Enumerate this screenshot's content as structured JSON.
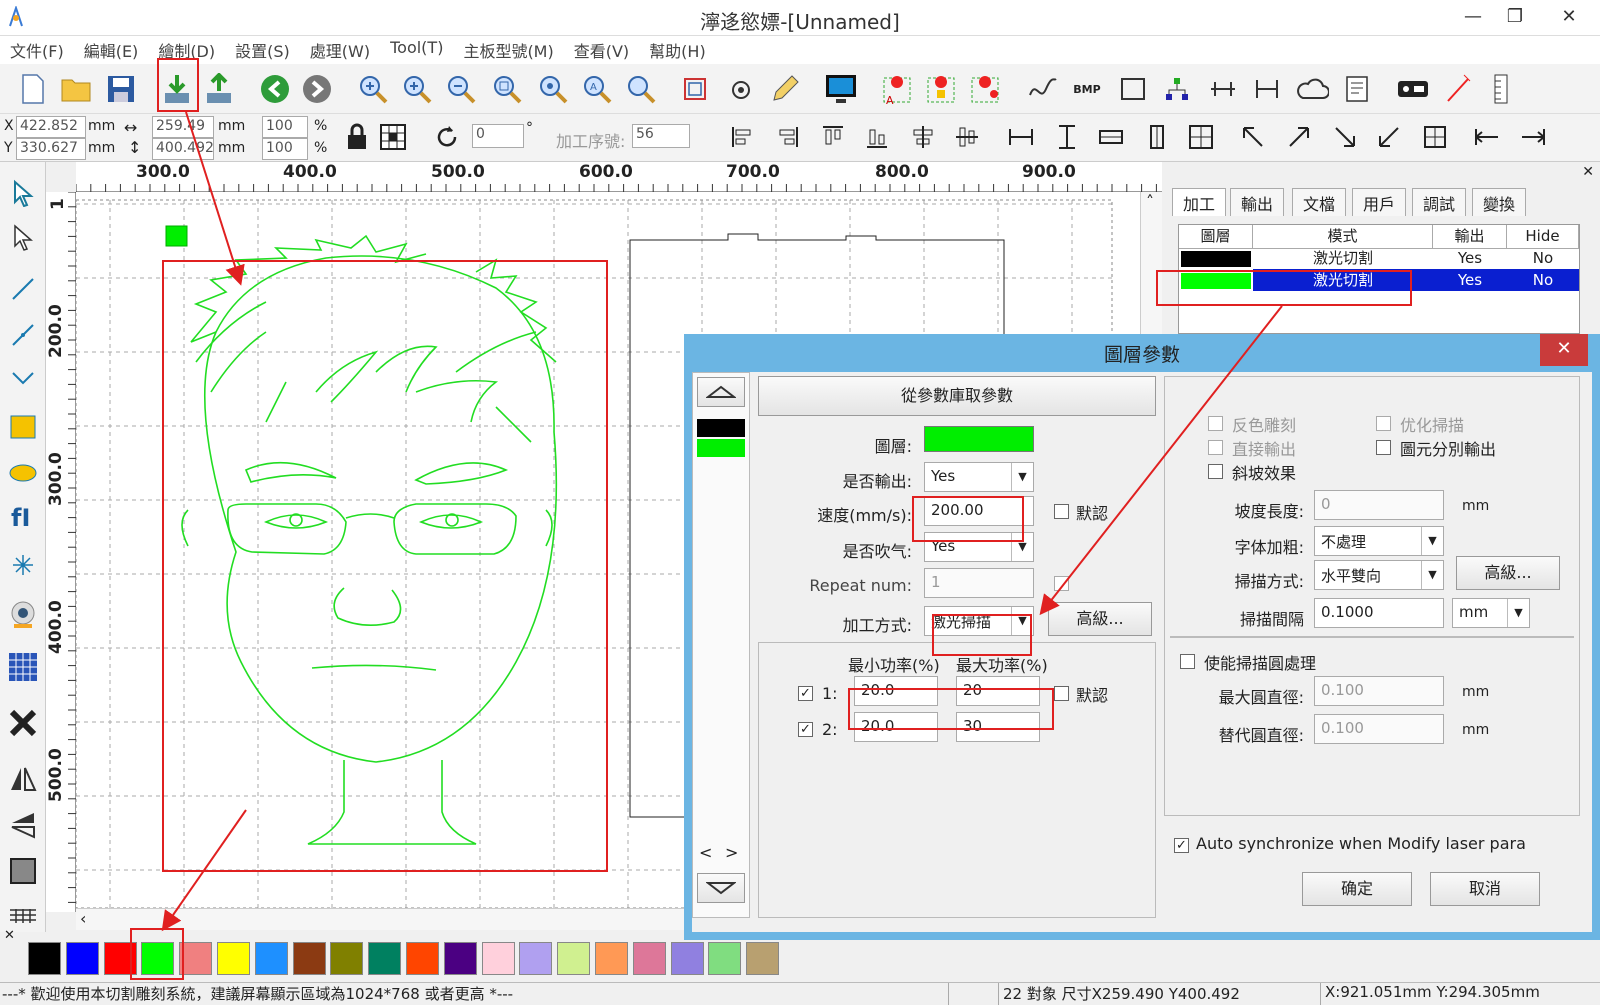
{
  "window": {
    "title": "濘迻慾嫖-[Unnamed]",
    "min": "—",
    "max": "❐",
    "close": "✕"
  },
  "menu": [
    "文件(F)",
    "編輯(E)",
    "繪制(D)",
    "設置(S)",
    "處理(W)",
    "Tool(T)",
    "主板型號(M)",
    "查看(V)",
    "幫助(H)"
  ],
  "coords": {
    "x_label": "X",
    "x_value": "422.852",
    "y_label": "Y",
    "y_value": "330.627",
    "unit": "mm",
    "width_value": "259.49",
    "height_value": "400.492",
    "scale_w": "100",
    "scale_h": "100",
    "pct": "%",
    "rotate_value": "0",
    "degree": "°",
    "order_label": "加工序號:",
    "order_value": "56"
  },
  "ruler": {
    "h": [
      "300.0",
      "400.0",
      "500.0",
      "600.0",
      "700.0",
      "800.0",
      "900.0"
    ],
    "v": [
      "200.0",
      "300.0",
      "400.0",
      "500.0"
    ],
    "v_top": "1"
  },
  "right_panel": {
    "tabs": [
      "加工",
      "輸出",
      "文檔",
      "用戶",
      "調試",
      "變換"
    ],
    "headers": [
      "圖層",
      "模式",
      "輸出",
      "Hide"
    ],
    "rows": [
      {
        "color": "#000000",
        "mode": "激光切割",
        "output": "Yes",
        "hide": "No"
      },
      {
        "color": "#00ff00",
        "mode": "激光切割",
        "output": "Yes",
        "hide": "No"
      }
    ]
  },
  "dialog": {
    "title": "圖層參數",
    "close": "✕",
    "get_params_button": "從參數庫取參數",
    "layer_label": "圖層:",
    "output_label": "是否輸出:",
    "output_value": "Yes",
    "speed_label": "速度(mm/s):",
    "speed_value": "200.00",
    "default_label": "默認",
    "blow_label": "是否吹气:",
    "blow_value": "Yes",
    "repeat_label": "Repeat num:",
    "repeat_value": "1",
    "process_label": "加工方式:",
    "process_value": "激光掃描",
    "advanced_button": "高級...",
    "min_power_label": "最小功率(%)",
    "max_power_label": "最大功率(%)",
    "power_rows": [
      {
        "idx": "1:",
        "min": "20.0",
        "max": "20"
      },
      {
        "idx": "2:",
        "min": "20.0",
        "max": "30"
      }
    ],
    "default_label2": "默認",
    "reverse_engrave": "反色雕刻",
    "optimize_scan": "优化掃描",
    "direct_output": "直接輸出",
    "element_output": "圖元分別輸出",
    "slope_effect": "斜坡效果",
    "slope_len_label": "坡度長度:",
    "slope_len_value": "0",
    "mm": "mm",
    "font_bold_label": "字体加粗:",
    "font_bold_value": "不處理",
    "scan_mode_label": "掃描方式:",
    "scan_mode_value": "水平雙向",
    "scan_adv_button": "高級...",
    "scan_gap_label": "掃描間隔",
    "scan_gap_value": "0.1000",
    "scan_gap_unit": "mm",
    "enable_circle": "使能掃描圓處理",
    "max_circle_label": "最大圓直徑:",
    "max_circle_value": "0.100",
    "alt_circle_label": "替代圓直徑:",
    "alt_circle_value": "0.100",
    "auto_sync": "Auto synchronize when Modify laser para",
    "ok_button": "确定",
    "cancel_button": "取消",
    "nav_left": "<",
    "nav_right": ">"
  },
  "palette": [
    "#000000",
    "#0000ff",
    "#ff0000",
    "#00ff00",
    "#f08080",
    "#ffff00",
    "#1e90ff",
    "#8b3a12",
    "#808000",
    "#008060",
    "#ff4500",
    "#4b0082",
    "#ffd0dc",
    "#b0a0f0",
    "#d0f090",
    "#ff9955",
    "#dd7799",
    "#9080e0",
    "#80dd80",
    "#b8a070"
  ],
  "status": {
    "left": "---* 歡迎使用本切割雕刻系統，建議屏幕顯示區域為1024*768 或者更高 *---",
    "mid": "22 對象 尺寸X259.490 Y400.492",
    "right": "X:921.051mm Y:294.305mm"
  }
}
